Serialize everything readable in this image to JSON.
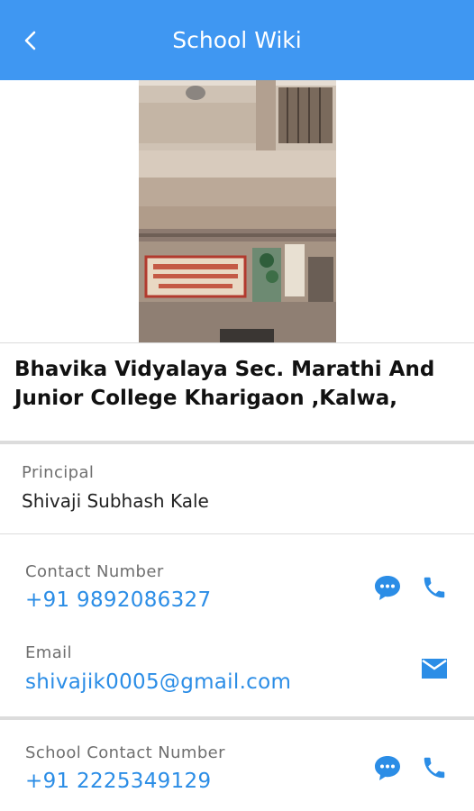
{
  "appbar": {
    "title": "School Wiki",
    "back_icon": "back-chevron-icon",
    "color": "#3f97f2"
  },
  "school": {
    "name": "Bhavika Vidyalaya Sec. Marathi And Junior College Kharigaon ,Kalwa,"
  },
  "principal": {
    "label": "Principal",
    "value": "Shivaji Subhash Kale"
  },
  "contact": {
    "label": "Contact Number",
    "value": "+91 9892086327",
    "icons": [
      "message-bubble-icon",
      "phone-icon"
    ]
  },
  "email": {
    "label": "Email",
    "value": "shivajik0005@gmail.com",
    "icons": [
      "mail-icon"
    ]
  },
  "school_contact": {
    "label": "School Contact Number",
    "value": "+91 2225349129",
    "icons": [
      "message-bubble-icon",
      "phone-icon"
    ]
  },
  "colors": {
    "accent": "#2b8de6",
    "appbar": "#3f97f2"
  }
}
